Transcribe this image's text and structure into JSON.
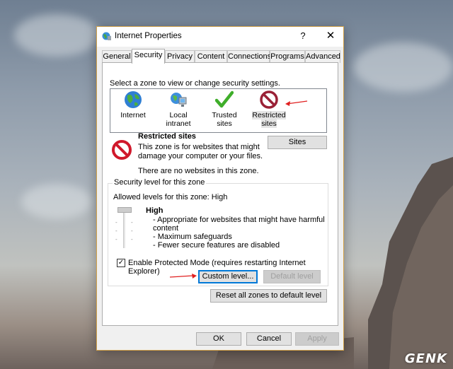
{
  "dialog": {
    "title": "Internet Properties",
    "help_label": "?",
    "close_label": "✕"
  },
  "tabs": [
    {
      "label": "General"
    },
    {
      "label": "Security"
    },
    {
      "label": "Privacy"
    },
    {
      "label": "Content"
    },
    {
      "label": "Connections"
    },
    {
      "label": "Programs"
    },
    {
      "label": "Advanced"
    }
  ],
  "active_tab": "Security",
  "security": {
    "prompt": "Select a zone to view or change security settings.",
    "zones": [
      {
        "label": "Internet",
        "icon": "globe-icon"
      },
      {
        "label": "Local intranet",
        "icon": "network-icon"
      },
      {
        "label": "Trusted sites",
        "icon": "checkmark-icon"
      },
      {
        "label": "Restricted sites",
        "icon": "prohibited-icon"
      }
    ],
    "selected_zone": "Restricted sites",
    "zone_title": "Restricted sites",
    "zone_desc_1": "This zone is for websites that might",
    "zone_desc_2": "damage your computer or your files.",
    "zone_empty": "There are no websites in this zone.",
    "sites_button": "Sites",
    "level_group_label": "Security level for this zone",
    "allowed_levels": "Allowed levels for this zone: High",
    "level_name": "High",
    "level_bullets": [
      "- Appropriate for websites that might have harmful",
      "content",
      "- Maximum safeguards",
      "- Fewer secure features are disabled"
    ],
    "protected_mode_label": "Enable Protected Mode (requires restarting Internet Explorer)",
    "protected_mode_checked": true,
    "custom_level_button": "Custom level...",
    "default_level_button": "Default level",
    "reset_all_button": "Reset all zones to default level"
  },
  "footer": {
    "ok": "OK",
    "cancel": "Cancel",
    "apply": "Apply"
  },
  "watermark": "GENK",
  "colors": {
    "annotation_arrow": "#e02020",
    "focus_blue": "#0078d7",
    "prohibited_red": "#c8102e"
  }
}
